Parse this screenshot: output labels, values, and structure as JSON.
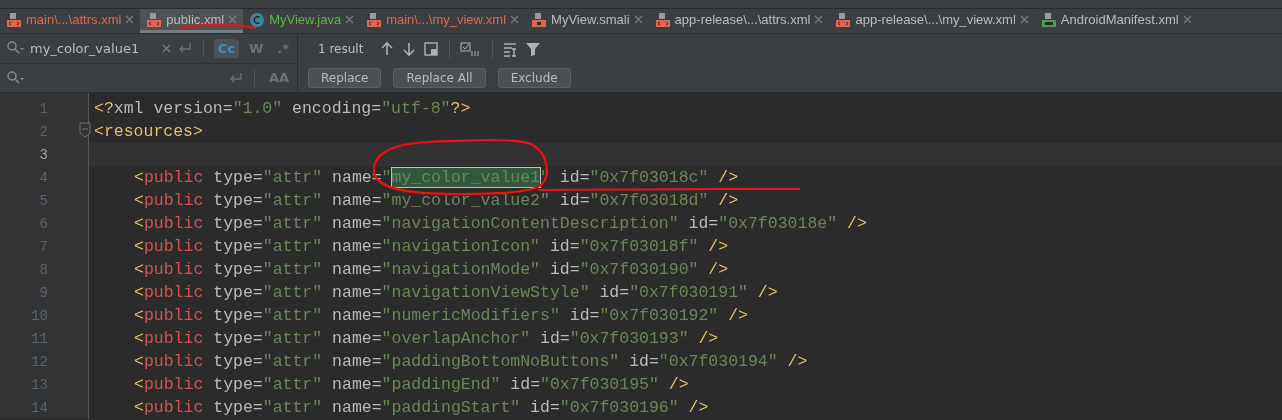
{
  "tabs": [
    {
      "label": "main\\...\\attrs.xml",
      "kind": "xml",
      "color": "#e0674f",
      "selected": false
    },
    {
      "label": "public.xml",
      "kind": "xml",
      "color": "#bbbbbb",
      "selected": true
    },
    {
      "label": "MyView.java",
      "kind": "java",
      "color": "#62b543",
      "selected": false
    },
    {
      "label": "main\\...\\my_view.xml",
      "kind": "xml",
      "color": "#e0674f",
      "selected": false
    },
    {
      "label": "MyView.smali",
      "kind": "smali",
      "color": "#bbbbbb",
      "selected": false
    },
    {
      "label": "app-release\\...\\attrs.xml",
      "kind": "xml",
      "color": "#bbbbbb",
      "selected": false
    },
    {
      "label": "app-release\\...\\my_view.xml",
      "kind": "xml",
      "color": "#bbbbbb",
      "selected": false
    },
    {
      "label": "AndroidManifest.xml",
      "kind": "manifest",
      "color": "#bbbbbb",
      "selected": false
    }
  ],
  "search": {
    "value": "my_color_value1",
    "toggles": [
      {
        "label": "Cc",
        "selected": true
      },
      {
        "label": "W",
        "selected": false
      },
      {
        "label": ".*",
        "selected": false
      }
    ],
    "result": "1 result"
  },
  "replace": {
    "toggle": "AA",
    "buttons": [
      "Replace",
      "Replace All",
      "Exclude"
    ]
  },
  "lines": [
    {
      "number": "1",
      "segments": [
        {
          "kind": "punct",
          "text": "<?"
        },
        {
          "kind": "attr",
          "text": "xml version="
        },
        {
          "kind": "value",
          "text": "\"1.0\""
        },
        {
          "kind": "attr",
          "text": " encoding="
        },
        {
          "kind": "value",
          "text": "\"utf-8\""
        },
        {
          "kind": "punct",
          "text": "?>"
        }
      ]
    },
    {
      "number": "2",
      "fold": true,
      "segments": [
        {
          "kind": "punct",
          "text": "<resources>"
        }
      ]
    },
    {
      "number": "3",
      "current": true
    },
    {
      "number": "4",
      "nested": true,
      "segments": [
        {
          "kind": "punct",
          "text": "<"
        },
        {
          "kind": "tag",
          "text": "public"
        },
        {
          "kind": "attr",
          "text": " type="
        },
        {
          "kind": "value",
          "text": "\"attr\""
        },
        {
          "kind": "attr",
          "text": " name="
        },
        {
          "kind": "value",
          "text": "\""
        },
        {
          "kind": "match",
          "text": "my_color_value1"
        },
        {
          "kind": "value",
          "text": "\""
        },
        {
          "kind": "attr",
          "text": " id="
        },
        {
          "kind": "value",
          "text": "\"0x7f03018c\""
        },
        {
          "kind": "punct",
          "text": " />"
        }
      ]
    },
    {
      "number": "5",
      "nested": true,
      "segments": [
        {
          "kind": "punct",
          "text": "<"
        },
        {
          "kind": "tag",
          "text": "public"
        },
        {
          "kind": "attr",
          "text": " type="
        },
        {
          "kind": "value",
          "text": "\"attr\""
        },
        {
          "kind": "attr",
          "text": " name="
        },
        {
          "kind": "value",
          "text": "\"my_color_value2\""
        },
        {
          "kind": "attr",
          "text": " id="
        },
        {
          "kind": "value",
          "text": "\"0x7f03018d\""
        },
        {
          "kind": "punct",
          "text": " />"
        }
      ]
    },
    {
      "number": "6",
      "nested": true,
      "segments": [
        {
          "kind": "punct",
          "text": "<"
        },
        {
          "kind": "tag",
          "text": "public"
        },
        {
          "kind": "attr",
          "text": " type="
        },
        {
          "kind": "value",
          "text": "\"attr\""
        },
        {
          "kind": "attr",
          "text": " name="
        },
        {
          "kind": "value",
          "text": "\"navigationContentDescription\""
        },
        {
          "kind": "attr",
          "text": " id="
        },
        {
          "kind": "value",
          "text": "\"0x7f03018e\""
        },
        {
          "kind": "punct",
          "text": " />"
        }
      ]
    },
    {
      "number": "7",
      "nested": true,
      "segments": [
        {
          "kind": "punct",
          "text": "<"
        },
        {
          "kind": "tag",
          "text": "public"
        },
        {
          "kind": "attr",
          "text": " type="
        },
        {
          "kind": "value",
          "text": "\"attr\""
        },
        {
          "kind": "attr",
          "text": " name="
        },
        {
          "kind": "value",
          "text": "\"navigationIcon\""
        },
        {
          "kind": "attr",
          "text": " id="
        },
        {
          "kind": "value",
          "text": "\"0x7f03018f\""
        },
        {
          "kind": "punct",
          "text": " />"
        }
      ]
    },
    {
      "number": "8",
      "nested": true,
      "segments": [
        {
          "kind": "punct",
          "text": "<"
        },
        {
          "kind": "tag",
          "text": "public"
        },
        {
          "kind": "attr",
          "text": " type="
        },
        {
          "kind": "value",
          "text": "\"attr\""
        },
        {
          "kind": "attr",
          "text": " name="
        },
        {
          "kind": "value",
          "text": "\"navigationMode\""
        },
        {
          "kind": "attr",
          "text": " id="
        },
        {
          "kind": "value",
          "text": "\"0x7f030190\""
        },
        {
          "kind": "punct",
          "text": " />"
        }
      ]
    },
    {
      "number": "9",
      "nested": true,
      "segments": [
        {
          "kind": "punct",
          "text": "<"
        },
        {
          "kind": "tag",
          "text": "public"
        },
        {
          "kind": "attr",
          "text": " type="
        },
        {
          "kind": "value",
          "text": "\"attr\""
        },
        {
          "kind": "attr",
          "text": " name="
        },
        {
          "kind": "value",
          "text": "\"navigationViewStyle\""
        },
        {
          "kind": "attr",
          "text": " id="
        },
        {
          "kind": "value",
          "text": "\"0x7f030191\""
        },
        {
          "kind": "punct",
          "text": " />"
        }
      ]
    },
    {
      "number": "10",
      "nested": true,
      "segments": [
        {
          "kind": "punct",
          "text": "<"
        },
        {
          "kind": "tag",
          "text": "public"
        },
        {
          "kind": "attr",
          "text": " type="
        },
        {
          "kind": "value",
          "text": "\"attr\""
        },
        {
          "kind": "attr",
          "text": " name="
        },
        {
          "kind": "value",
          "text": "\"numericModifiers\""
        },
        {
          "kind": "attr",
          "text": " id="
        },
        {
          "kind": "value",
          "text": "\"0x7f030192\""
        },
        {
          "kind": "punct",
          "text": " />"
        }
      ]
    },
    {
      "number": "11",
      "nested": true,
      "segments": [
        {
          "kind": "punct",
          "text": "<"
        },
        {
          "kind": "tag",
          "text": "public"
        },
        {
          "kind": "attr",
          "text": " type="
        },
        {
          "kind": "value",
          "text": "\"attr\""
        },
        {
          "kind": "attr",
          "text": " name="
        },
        {
          "kind": "value",
          "text": "\"overlapAnchor\""
        },
        {
          "kind": "attr",
          "text": " id="
        },
        {
          "kind": "value",
          "text": "\"0x7f030193\""
        },
        {
          "kind": "punct",
          "text": " />"
        }
      ]
    },
    {
      "number": "12",
      "nested": true,
      "segments": [
        {
          "kind": "punct",
          "text": "<"
        },
        {
          "kind": "tag",
          "text": "public"
        },
        {
          "kind": "attr",
          "text": " type="
        },
        {
          "kind": "value",
          "text": "\"attr\""
        },
        {
          "kind": "attr",
          "text": " name="
        },
        {
          "kind": "value",
          "text": "\"paddingBottomNoButtons\""
        },
        {
          "kind": "attr",
          "text": " id="
        },
        {
          "kind": "value",
          "text": "\"0x7f030194\""
        },
        {
          "kind": "punct",
          "text": " />"
        }
      ]
    },
    {
      "number": "13",
      "nested": true,
      "segments": [
        {
          "kind": "punct",
          "text": "<"
        },
        {
          "kind": "tag",
          "text": "public"
        },
        {
          "kind": "attr",
          "text": " type="
        },
        {
          "kind": "value",
          "text": "\"attr\""
        },
        {
          "kind": "attr",
          "text": " name="
        },
        {
          "kind": "value",
          "text": "\"paddingEnd\""
        },
        {
          "kind": "attr",
          "text": " id="
        },
        {
          "kind": "value",
          "text": "\"0x7f030195\""
        },
        {
          "kind": "punct",
          "text": " />"
        }
      ]
    },
    {
      "number": "14",
      "nested": true,
      "segments": [
        {
          "kind": "punct",
          "text": "<"
        },
        {
          "kind": "tag",
          "text": "public"
        },
        {
          "kind": "attr",
          "text": " type="
        },
        {
          "kind": "value",
          "text": "\"attr\""
        },
        {
          "kind": "attr",
          "text": " name="
        },
        {
          "kind": "value",
          "text": "\"paddingStart\""
        },
        {
          "kind": "attr",
          "text": " id="
        },
        {
          "kind": "value",
          "text": "\"0x7f030196\""
        },
        {
          "kind": "punct",
          "text": " />"
        }
      ]
    }
  ]
}
